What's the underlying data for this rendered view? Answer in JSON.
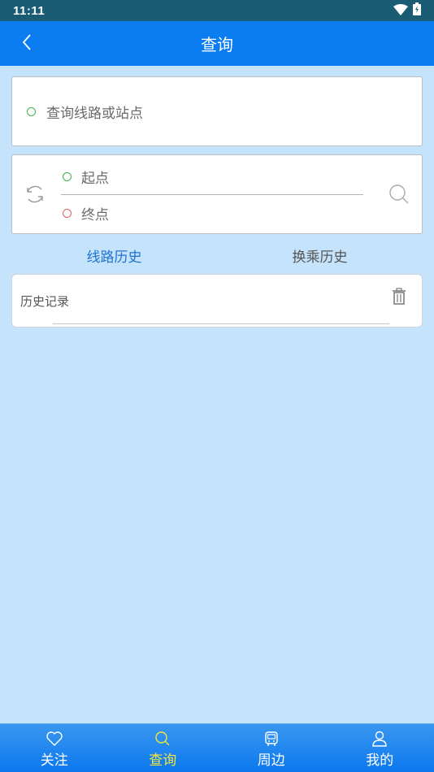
{
  "status_bar": {
    "time": "11:11"
  },
  "app_bar": {
    "title": "查询"
  },
  "search": {
    "placeholder": "查询线路或站点"
  },
  "route": {
    "start_placeholder": "起点",
    "end_placeholder": "终点"
  },
  "tabs": [
    {
      "label": "线路历史",
      "active": true
    },
    {
      "label": "换乘历史",
      "active": false
    }
  ],
  "history": {
    "title": "历史记录"
  },
  "bottom_nav": [
    {
      "label": "关注",
      "icon": "heart-icon",
      "active": false
    },
    {
      "label": "查询",
      "icon": "search-icon",
      "active": true
    },
    {
      "label": "周边",
      "icon": "bus-icon",
      "active": false
    },
    {
      "label": "我的",
      "icon": "person-icon",
      "active": false
    }
  ],
  "colors": {
    "app_bar": "#0c7df0",
    "background": "#c5e3fb",
    "active_tab": "#1f73cf",
    "active_nav": "#f4e63a",
    "start_dot": "#3cb24a",
    "end_dot": "#e06060"
  }
}
